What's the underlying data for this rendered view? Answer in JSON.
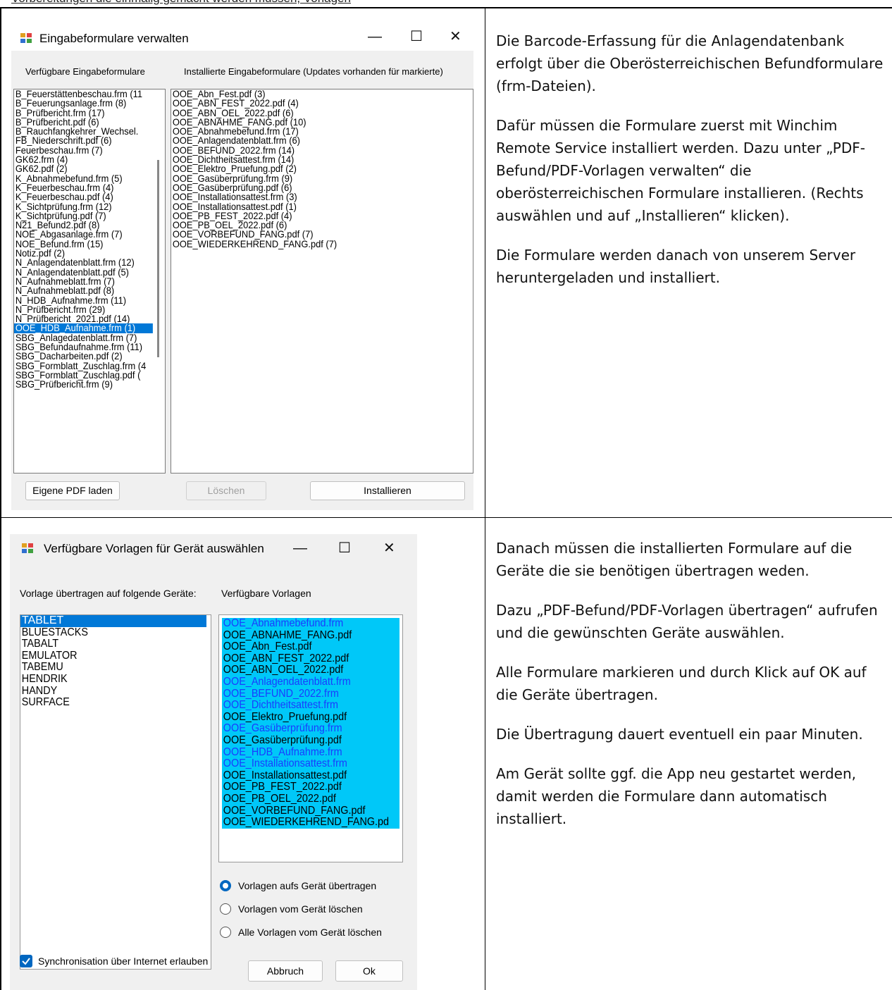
{
  "header_fragment": "Vorbereitungen die einmalig gemacht werden müssen, Vorlagen",
  "dialog1": {
    "title": "Eingabeformulare verwalten",
    "left_header": "Verfügbare Eingabeformulare",
    "right_header": "Installierte Eingabeformulare (Updates vorhanden für markierte)",
    "available": [
      "B_Feuerstättenbeschau.frm (11",
      "B_Feuerungsanlage.frm (8)",
      "B_Prüfbericht.frm (17)",
      "B_Prüfbericht.pdf (6)",
      "B_Rauchfangkehrer_Wechsel.",
      "FB_Niederschrift.pdf (6)",
      "Feuerbeschau.frm (7)",
      "GK62.frm (4)",
      "GK62.pdf (2)",
      "K_Abnahmebefund.frm (5)",
      "K_Feuerbeschau.frm (4)",
      "K_Feuerbeschau.pdf (4)",
      "K_Sichtprüfung.frm (12)",
      "K_Sichtprüfung.pdf (7)",
      "N21_Befund2.pdf (8)",
      "NOE_Abgasanlage.frm (7)",
      "NOE_Befund.frm (15)",
      "Notiz.pdf (2)",
      "N_Anlagendatenblatt.frm (12)",
      "N_Anlagendatenblatt.pdf (5)",
      "N_Aufnahmeblatt.frm (7)",
      "N_Aufnahmeblatt.pdf (8)",
      "N_HDB_Aufnahme.frm (11)",
      "N_Prüfbericht.frm (29)",
      "N_Prüfbericht_2021.pdf (14)",
      "OOE_HDB_Aufnahme.frm (1)",
      "SBG_Anlagedatenblatt.frm (7)",
      "SBG_Befundaufnahme.frm (11)",
      "SBG_Dacharbeiten.pdf (2)",
      "SBG_Formblatt_Zuschlag.frm (4",
      "SBG_Formblatt_Zuschlag.pdf (",
      "SBG_Prüfbericht.frm (9)"
    ],
    "selected_index": 25,
    "installed": [
      "OOE_Abn_Fest.pdf (3)",
      "OOE_ABN_FEST_2022.pdf (4)",
      "OOE_ABN_OEL_2022.pdf (6)",
      "OOE_ABNAHME_FANG.pdf (10)",
      "OOE_Abnahmebefund.frm (17)",
      "OOE_Anlagendatenblatt.frm (6)",
      "OOE_BEFUND_2022.frm (14)",
      "OOE_Dichtheitsattest.frm (14)",
      "OOE_Elektro_Pruefung.pdf (2)",
      "OOE_Gasüberprüfung.frm (9)",
      "OOE_Gasüberprüfung.pdf (6)",
      "OOE_Installationsattest.frm (3)",
      "OOE_Installationsattest.pdf (1)",
      "OOE_PB_FEST_2022.pdf (4)",
      "OOE_PB_OEL_2022.pdf (6)",
      "OOE_VORBEFUND_FANG.pdf (7)",
      "OOE_WIEDERKEHREND_FANG.pdf (7)"
    ],
    "btn_load": "Eigene PDF laden",
    "btn_delete": "Löschen",
    "btn_install": "Installieren"
  },
  "text1": [
    "Die Barcode-Erfassung für die Anlagendatenbank erfolgt über die Oberösterreichischen Befundformulare (frm-Dateien).",
    "Dafür müssen die Formulare zuerst mit Winchim Remote Service installiert werden. Dazu unter „PDF-Befund/PDF-Vorlagen verwalten“ die oberösterreichischen Formulare installieren. (Rechts auswählen und auf „Installieren“ klicken).",
    "Die Formulare werden danach von unserem Server heruntergeladen und installiert."
  ],
  "dialog2": {
    "title": "Verfügbare Vorlagen für Gerät auswählen",
    "devices_header": "Vorlage übertragen auf folgende Geräte:",
    "templates_header": "Verfügbare Vorlagen",
    "devices": [
      "TABLET",
      "BLUESTACKS",
      "TABALT",
      "EMULATOR",
      "TABEMU",
      "HENDRIK",
      "HANDY",
      "SURFACE"
    ],
    "templates": [
      {
        "name": "OOE_Abnahmebefund.frm",
        "frm": true
      },
      {
        "name": "OOE_ABNAHME_FANG.pdf",
        "frm": false
      },
      {
        "name": "OOE_Abn_Fest.pdf",
        "frm": false
      },
      {
        "name": "OOE_ABN_FEST_2022.pdf",
        "frm": false
      },
      {
        "name": "OOE_ABN_OEL_2022.pdf",
        "frm": false
      },
      {
        "name": "OOE_Anlagendatenblatt.frm",
        "frm": true
      },
      {
        "name": "OOE_BEFUND_2022.frm",
        "frm": true
      },
      {
        "name": "OOE_Dichtheitsattest.frm",
        "frm": true
      },
      {
        "name": "OOE_Elektro_Pruefung.pdf",
        "frm": false
      },
      {
        "name": "OOE_Gasüberprüfung.frm",
        "frm": true
      },
      {
        "name": "OOE_Gasüberprüfung.pdf",
        "frm": false
      },
      {
        "name": "OOE_HDB_Aufnahme.frm",
        "frm": true
      },
      {
        "name": "OOE_Installationsattest.frm",
        "frm": true
      },
      {
        "name": "OOE_Installationsattest.pdf",
        "frm": false
      },
      {
        "name": "OOE_PB_FEST_2022.pdf",
        "frm": false
      },
      {
        "name": "OOE_PB_OEL_2022.pdf",
        "frm": false
      },
      {
        "name": "OOE_VORBEFUND_FANG.pdf",
        "frm": false
      },
      {
        "name": "OOE_WIEDERKEHREND_FANG.pd",
        "frm": false
      }
    ],
    "radio1": "Vorlagen aufs Gerät übertragen",
    "radio2": "Vorlagen vom Gerät löschen",
    "radio3": "Alle Vorlagen vom Gerät löschen",
    "checkbox": "Synchronisation über Internet erlauben",
    "btn_cancel": "Abbruch",
    "btn_ok": "Ok"
  },
  "text2": [
    "Danach müssen die installierten Formulare auf die Geräte die sie benötigen übertragen weden.",
    "Dazu „PDF-Befund/PDF-Vorlagen übertragen“ aufrufen und die gewünschten Geräte auswählen.",
    "Alle Formulare markieren und durch Klick auf OK auf die Geräte übertragen.",
    "Die Übertragung dauert eventuell ein paar Minuten.",
    "Am Gerät sollte ggf. die App neu gestartet werden, damit werden die Formulare dann automatisch installiert."
  ]
}
